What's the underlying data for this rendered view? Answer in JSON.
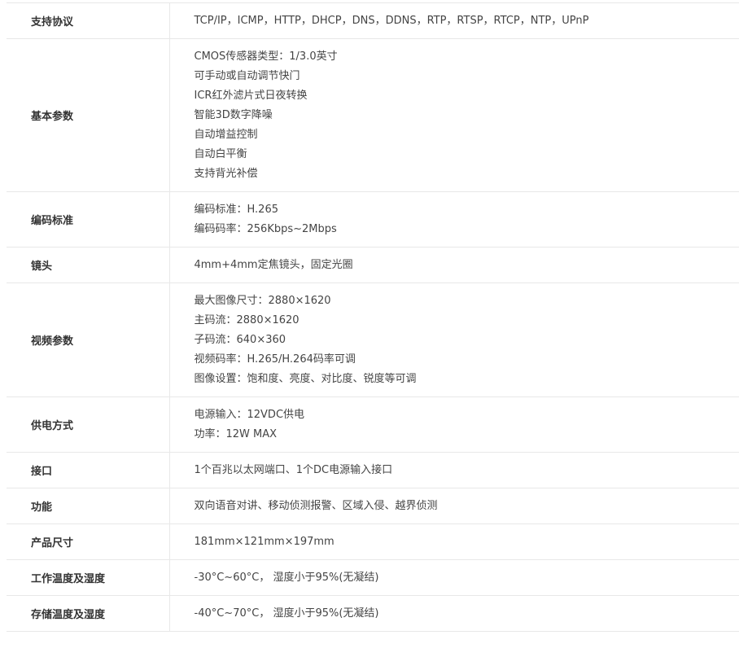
{
  "spec_rows": [
    {
      "label": "支持协议",
      "lines": [
        "TCP/IP，ICMP，HTTP，DHCP，DNS，DDNS，RTP，RTSP，RTCP，NTP，UPnP"
      ]
    },
    {
      "label": "基本参数",
      "lines": [
        "CMOS传感器类型：1/3.0英寸",
        "可手动或自动调节快门",
        "ICR红外滤片式日夜转换",
        "智能3D数字降噪",
        "自动增益控制",
        "自动白平衡",
        "支持背光补偿"
      ]
    },
    {
      "label": "编码标准",
      "lines": [
        "编码标准：H.265",
        "编码码率：256Kbps~2Mbps"
      ]
    },
    {
      "label": "镜头",
      "lines": [
        "4mm+4mm定焦镜头，固定光圈"
      ]
    },
    {
      "label": "视频参数",
      "lines": [
        "最大图像尺寸：2880×1620",
        "主码流：2880×1620",
        "子码流：640×360",
        "视频码率：H.265/H.264码率可调",
        "图像设置：饱和度、亮度、对比度、锐度等可调"
      ]
    },
    {
      "label": "供电方式",
      "lines": [
        "电源输入：12VDC供电",
        "功率：12W MAX"
      ]
    },
    {
      "label": "接口",
      "lines": [
        "1个百兆以太网端口、1个DC电源输入接口"
      ]
    },
    {
      "label": "功能",
      "lines": [
        "双向语音对讲、移动侦测报警、区域入侵、越界侦测"
      ]
    },
    {
      "label": "产品尺寸",
      "lines": [
        "181mm×121mm×197mm"
      ]
    },
    {
      "label": "工作温度及湿度",
      "lines": [
        "-30°C~60°C， 湿度小于95%(无凝结)"
      ]
    },
    {
      "label": "存储温度及湿度",
      "lines": [
        "-40°C~70°C， 湿度小于95%(无凝结)"
      ]
    }
  ]
}
